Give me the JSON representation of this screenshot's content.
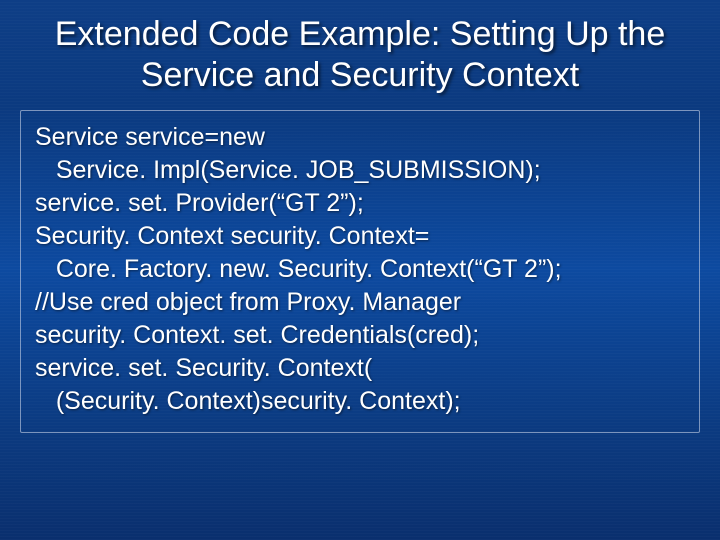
{
  "title": "Extended Code Example: Setting Up the Service and Security Context",
  "code": {
    "l1": "Service service=new",
    "l2": "   Service. Impl(Service. JOB_SUBMISSION);",
    "l3": "service. set. Provider(“GT 2”);",
    "l4": "Security. Context security. Context=",
    "l5": "   Core. Factory. new. Security. Context(“GT 2”);",
    "l6": "//Use cred object from Proxy. Manager",
    "l7": "security. Context. set. Credentials(cred);",
    "l8": "service. set. Security. Context(",
    "l9": "   (Security. Context)security. Context);"
  }
}
